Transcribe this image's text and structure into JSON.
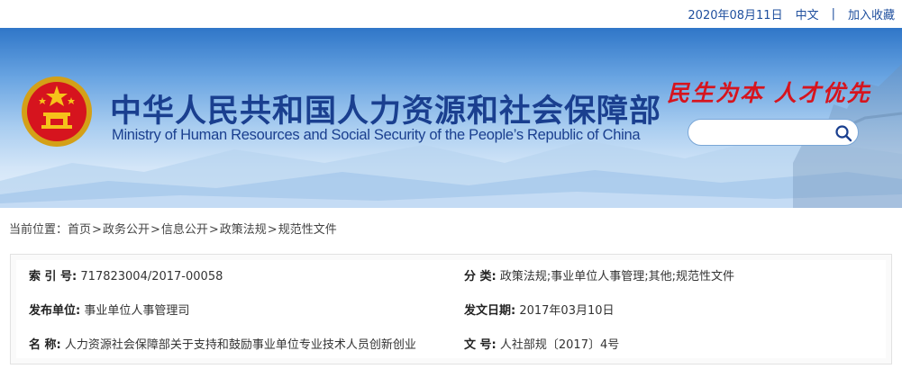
{
  "topbar": {
    "date": "2020年08月11日",
    "lang": "中文",
    "separator": "|",
    "favorite": "加入收藏"
  },
  "header": {
    "title_cn": "中华人民共和国人力资源和社会保障部",
    "title_en": "Ministry of Human Resources and Social Security of the People’s Republic of China",
    "slogan": "民生为本 人才优先",
    "emblem_icon": "national-emblem-icon",
    "search": {
      "value": "",
      "placeholder": "",
      "icon": "search-icon"
    }
  },
  "breadcrumb": {
    "prefix": "当前位置：",
    "separator": ">",
    "items": [
      "首页",
      "政务公开",
      "信息公开",
      "政策法规",
      "规范性文件"
    ]
  },
  "doc_info": {
    "index_label": "索 引 号:",
    "index_value": "717823004/2017-00058",
    "category_label": "分  类:",
    "category_value": "政策法规;事业单位人事管理;其他;规范性文件",
    "issuer_label": "发布单位:",
    "issuer_value": "事业单位人事管理司",
    "date_label": "发文日期:",
    "date_value": "2017年03月10日",
    "name_label": "名  称:",
    "name_value": "人力资源社会保障部关于支持和鼓励事业单位专业技术人员创新创业",
    "docno_label": "文  号:",
    "docno_value": "人社部规〔2017〕4号"
  },
  "colors": {
    "brand_blue": "#1a3f8f",
    "link_blue": "#1f4f9e",
    "slogan_red": "#d6141e"
  }
}
